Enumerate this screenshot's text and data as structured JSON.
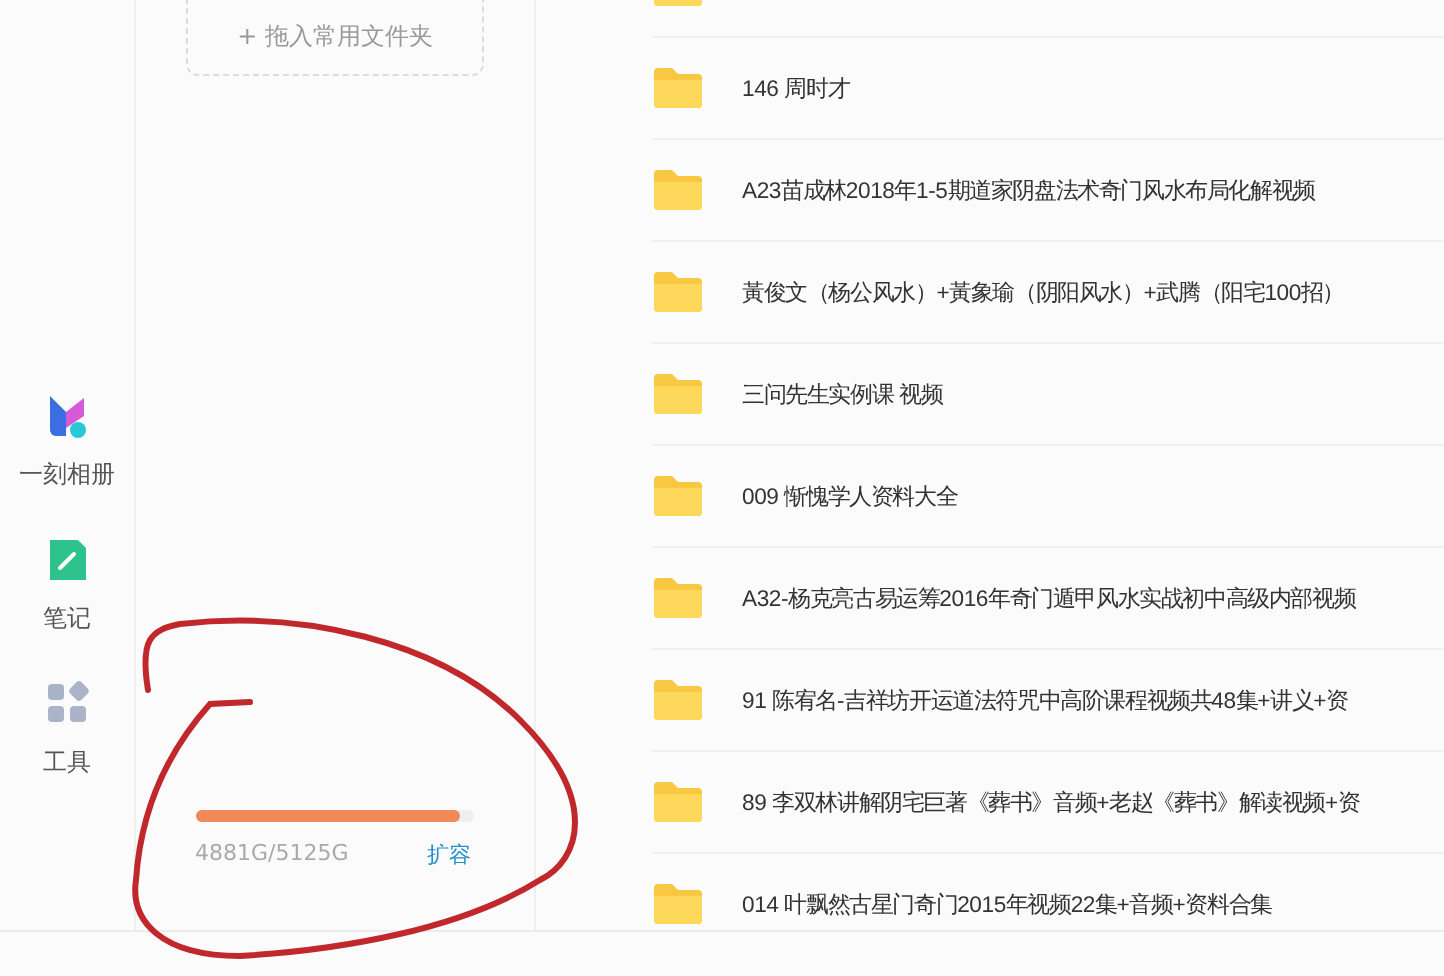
{
  "nav": [
    {
      "label": "一刻相册",
      "kind": "album"
    },
    {
      "label": "笔记",
      "kind": "note"
    },
    {
      "label": "工具",
      "kind": "tools"
    }
  ],
  "quick_access": {
    "drop_target": "+ 拖入常用文件夹"
  },
  "storage": {
    "level": 0.952,
    "usage": "4881G/5125G",
    "expand_link": "扩容"
  },
  "files": [
    {
      "name": "146 周时才"
    },
    {
      "name": "A23苗成林2018年1-5期道家阴盘法术奇门风水布局化解视频"
    },
    {
      "name": "黃俊文（杨公风水）+黃象瑜（阴阳风水）+武腾（阳宅100招）"
    },
    {
      "name": "三问先生实例课 视频"
    },
    {
      "name": "009 惭愧学人资料大全"
    },
    {
      "name": "A32-杨克亮古易运筹2016年奇门遁甲风水实战初中高级内部视频"
    },
    {
      "name": "91 陈宥名-吉祥坊开运道法符咒中高阶课程视频共48集+讲义+资"
    },
    {
      "name": "89 李双林讲解阴宅巨著《葬书》音频+老赵《葬书》解读视频+资"
    },
    {
      "name": "014 叶飘然古星门奇门2015年视频22集+音频+资料合集"
    }
  ]
}
